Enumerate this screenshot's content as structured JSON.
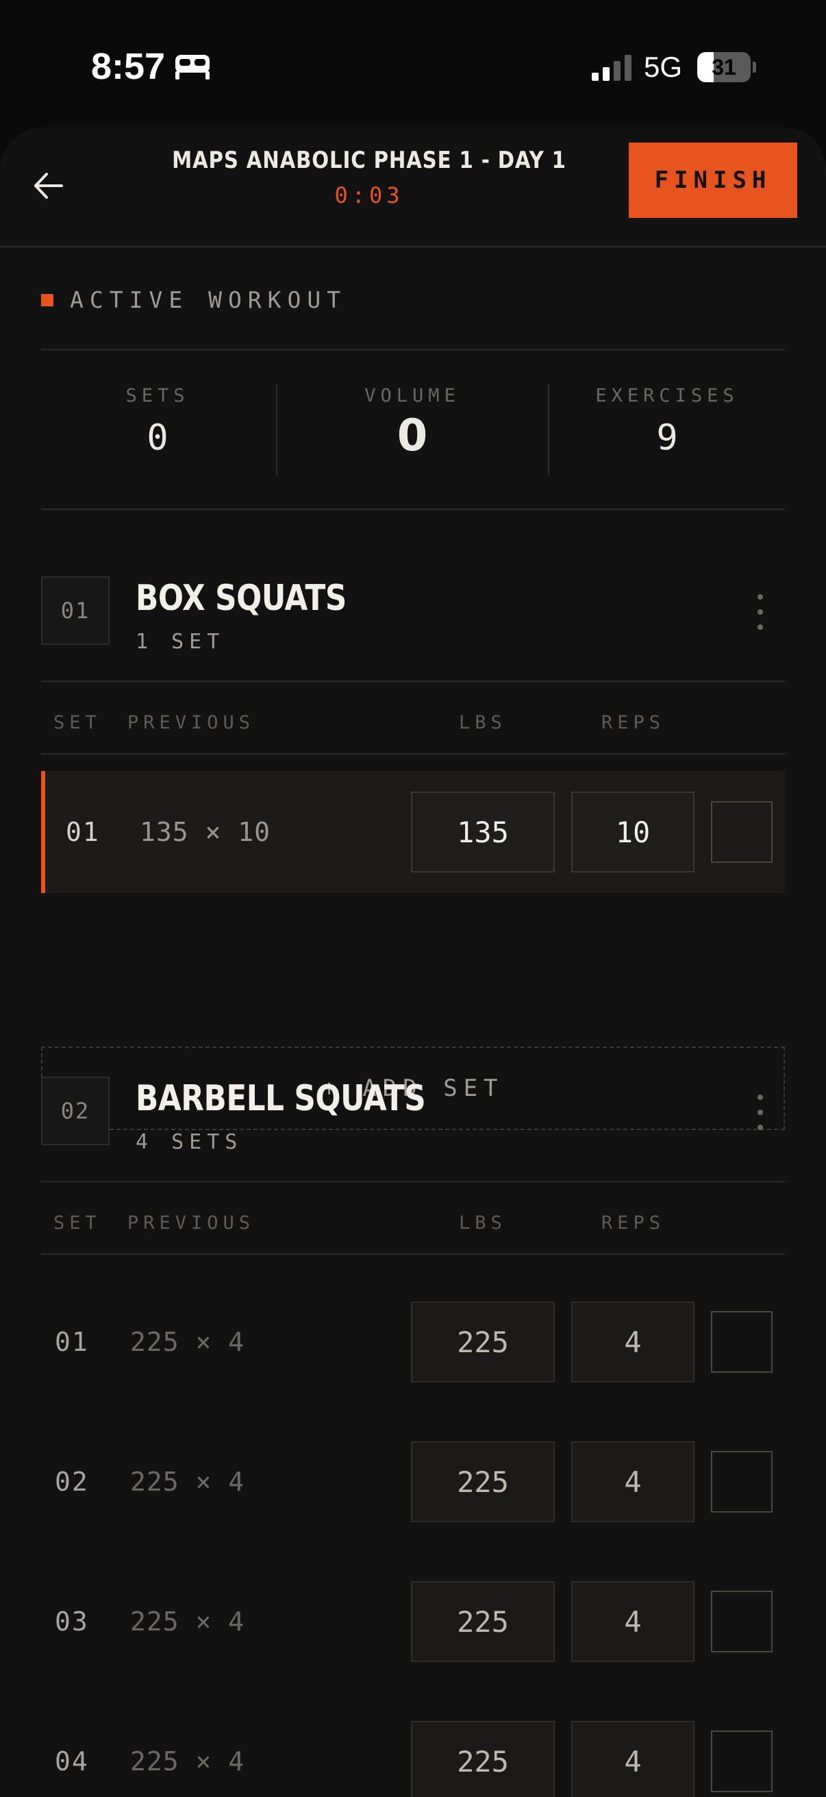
{
  "status_bar": {
    "time": "8:57",
    "sleep_icon": "bed-icon",
    "network": "5G",
    "battery_level": "31",
    "battery_fraction": 0.31
  },
  "header": {
    "back_icon": "arrow-left-icon",
    "title": "MAPS ANABOLIC PHASE 1 - DAY 1",
    "timer": "0:03",
    "finish_label": "FINISH",
    "accent_color": "#e8541e"
  },
  "section": {
    "label": "ACTIVE WORKOUT"
  },
  "stats": [
    {
      "label": "SETS",
      "value": "0"
    },
    {
      "label": "VOLUME",
      "value": "0"
    },
    {
      "label": "EXERCISES",
      "value": "9"
    }
  ],
  "columns": {
    "set": "SET",
    "previous": "PREVIOUS",
    "lbs": "LBS",
    "reps": "REPS"
  },
  "exercises": [
    {
      "number": "01",
      "name": "BOX SQUATS",
      "sets_label": "1 SET",
      "sets": [
        {
          "set": "01",
          "previous": "135 × 10",
          "lbs": "135",
          "reps": "10"
        }
      ],
      "add_set_label": "+ ADD SET"
    },
    {
      "number": "02",
      "name": "BARBELL SQUATS",
      "sets_label": "4 SETS",
      "sets": [
        {
          "set": "01",
          "previous": "225 × 4",
          "lbs": "225",
          "reps": "4"
        },
        {
          "set": "02",
          "previous": "225 × 4",
          "lbs": "225",
          "reps": "4"
        },
        {
          "set": "03",
          "previous": "225 × 4",
          "lbs": "225",
          "reps": "4"
        },
        {
          "set": "04",
          "previous": "225 × 4",
          "lbs": "225",
          "reps": "4"
        }
      ]
    }
  ]
}
